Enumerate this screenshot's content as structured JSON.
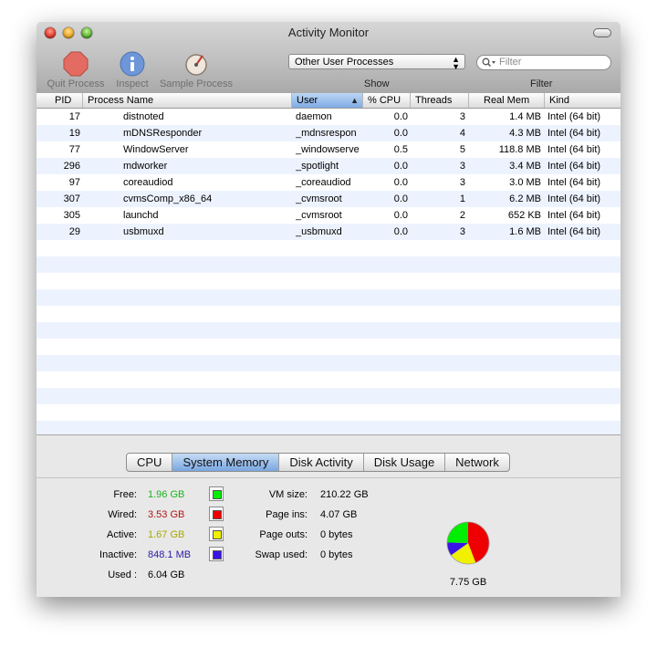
{
  "window": {
    "title": "Activity Monitor"
  },
  "toolbar": {
    "quit_label": "Quit Process",
    "inspect_label": "Inspect",
    "sample_label": "Sample Process",
    "show_label": "Show",
    "show_selected": "Other User Processes",
    "filter_label": "Filter",
    "search_placeholder": "Filter"
  },
  "table": {
    "columns": {
      "pid": "PID",
      "name": "Process Name",
      "user": "User",
      "cpu": "% CPU",
      "threads": "Threads",
      "mem": "Real Mem",
      "kind": "Kind"
    },
    "rows": [
      {
        "pid": "17",
        "name": "distnoted",
        "user": "daemon",
        "cpu": "0.0",
        "threads": "3",
        "mem": "1.4 MB",
        "kind": "Intel (64 bit)"
      },
      {
        "pid": "19",
        "name": "mDNSResponder",
        "user": "_mdnsrespon",
        "cpu": "0.0",
        "threads": "4",
        "mem": "4.3 MB",
        "kind": "Intel (64 bit)"
      },
      {
        "pid": "77",
        "name": "WindowServer",
        "user": "_windowserve",
        "cpu": "0.5",
        "threads": "5",
        "mem": "118.8 MB",
        "kind": "Intel (64 bit)"
      },
      {
        "pid": "296",
        "name": "mdworker",
        "user": "_spotlight",
        "cpu": "0.0",
        "threads": "3",
        "mem": "3.4 MB",
        "kind": "Intel (64 bit)"
      },
      {
        "pid": "97",
        "name": "coreaudiod",
        "user": "_coreaudiod",
        "cpu": "0.0",
        "threads": "3",
        "mem": "3.0 MB",
        "kind": "Intel (64 bit)"
      },
      {
        "pid": "307",
        "name": "cvmsComp_x86_64",
        "user": "_cvmsroot",
        "cpu": "0.0",
        "threads": "1",
        "mem": "6.2 MB",
        "kind": "Intel (64 bit)"
      },
      {
        "pid": "305",
        "name": "launchd",
        "user": "_cvmsroot",
        "cpu": "0.0",
        "threads": "2",
        "mem": "652 KB",
        "kind": "Intel (64 bit)"
      },
      {
        "pid": "29",
        "name": "usbmuxd",
        "user": "_usbmuxd",
        "cpu": "0.0",
        "threads": "3",
        "mem": "1.6 MB",
        "kind": "Intel (64 bit)"
      }
    ]
  },
  "tabs": [
    {
      "label": "CPU",
      "selected": false
    },
    {
      "label": "System Memory",
      "selected": true
    },
    {
      "label": "Disk Activity",
      "selected": false
    },
    {
      "label": "Disk Usage",
      "selected": false
    },
    {
      "label": "Network",
      "selected": false
    }
  ],
  "memory": {
    "free_label": "Free:",
    "free_value": "1.96 GB",
    "free_color": "#1bb51b",
    "free_swatch": "#00ee00",
    "wired_label": "Wired:",
    "wired_value": "3.53 GB",
    "wired_color": "#b11616",
    "wired_swatch": "#ee0000",
    "active_label": "Active:",
    "active_value": "1.67 GB",
    "active_color": "#a8a800",
    "active_swatch": "#f0f000",
    "inactive_label": "Inactive:",
    "inactive_value": "848.1 MB",
    "inactive_color": "#2a1aa8",
    "inactive_swatch": "#3a14e6",
    "used_label": "Used :",
    "used_value": "6.04 GB",
    "vm_size_label": "VM size:",
    "vm_size_value": "210.22 GB",
    "page_ins_label": "Page ins:",
    "page_ins_value": "4.07 GB",
    "page_outs_label": "Page outs:",
    "page_outs_value": "0 bytes",
    "swap_used_label": "Swap used:",
    "swap_used_value": "0 bytes",
    "total_value": "7.75 GB"
  }
}
